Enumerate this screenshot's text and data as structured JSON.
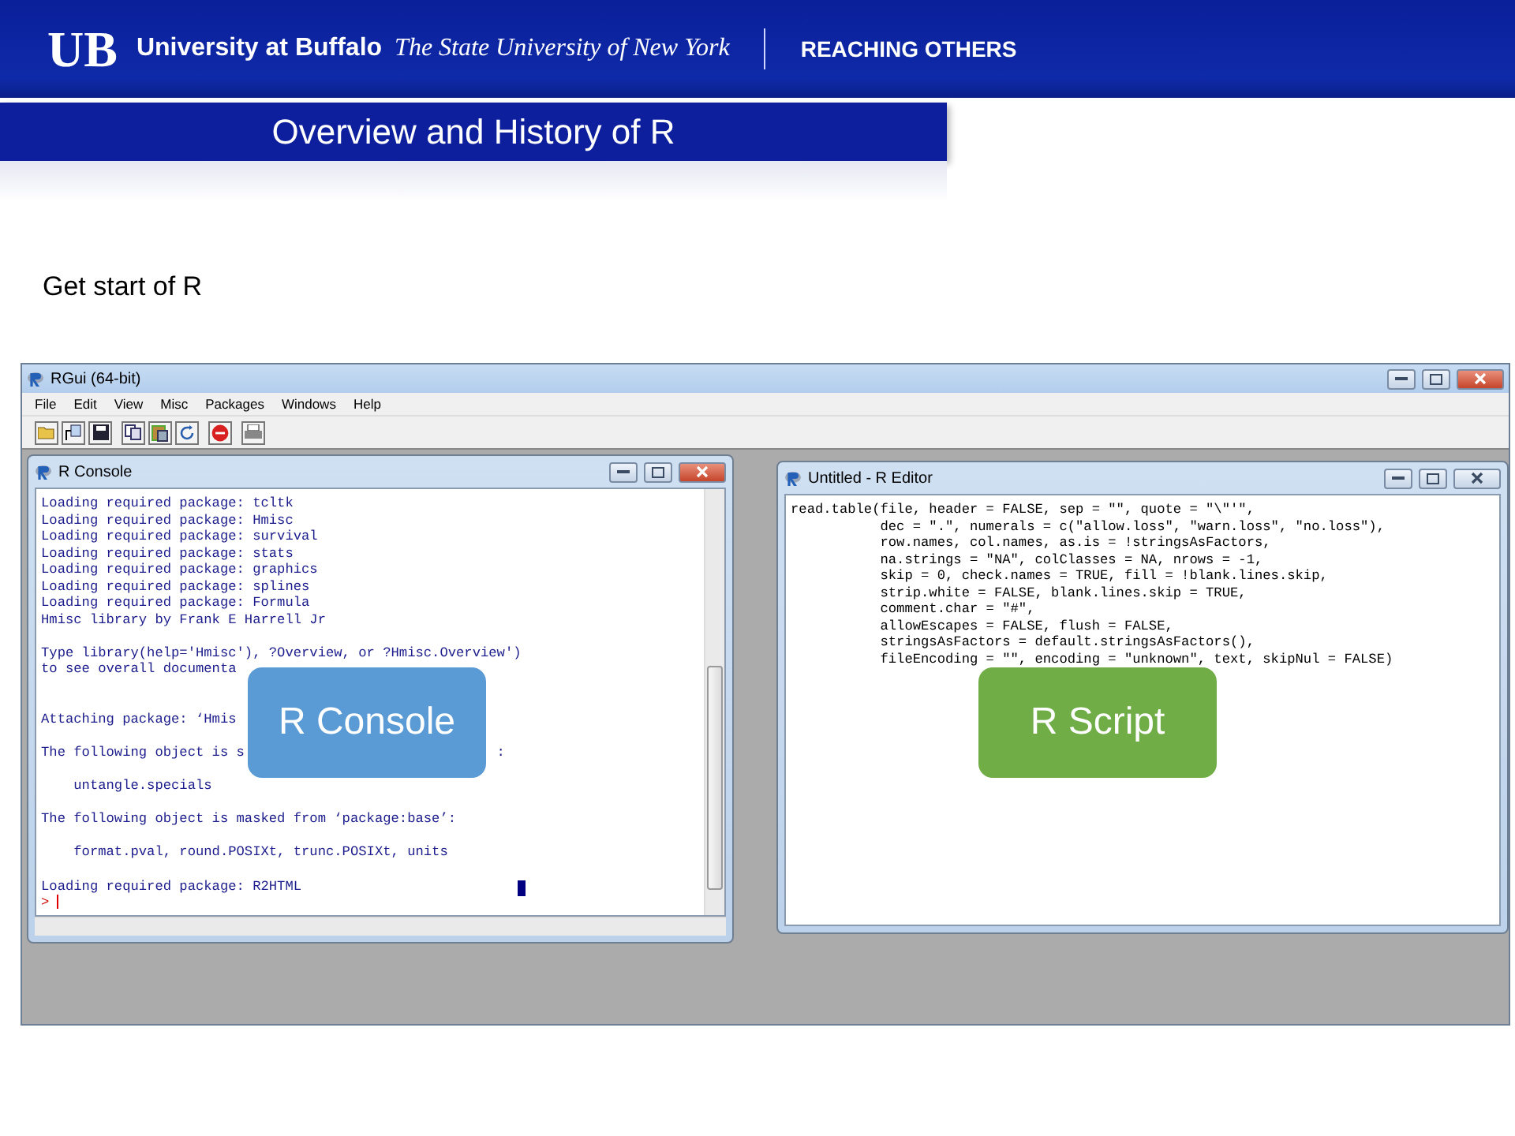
{
  "header": {
    "logo": "UB",
    "university": "University at Buffalo",
    "system": "The State University of New York",
    "tagline": "REACHING OTHERS"
  },
  "slide_title": "Overview and History of R",
  "subtitle": "Get start of R",
  "rgui": {
    "title": "RGui (64-bit)",
    "menu": [
      "File",
      "Edit",
      "View",
      "Misc",
      "Packages",
      "Windows",
      "Help"
    ],
    "toolbar": [
      {
        "kind": "open"
      },
      {
        "kind": "load"
      },
      {
        "kind": "save"
      },
      {
        "kind": "copy"
      },
      {
        "kind": "paste"
      },
      {
        "kind": "copy-paste"
      },
      {
        "kind": "stop"
      },
      {
        "kind": "print"
      }
    ],
    "console": {
      "title": "R Console",
      "active": true,
      "lines": [
        {
          "kind": "text",
          "text": "Loading required package: tcltk"
        },
        {
          "kind": "text",
          "text": "Loading required package: Hmisc"
        },
        {
          "kind": "text",
          "text": "Loading required package: survival"
        },
        {
          "kind": "text",
          "text": "Loading required package: stats"
        },
        {
          "kind": "text",
          "text": "Loading required package: graphics"
        },
        {
          "kind": "text",
          "text": "Loading required package: splines"
        },
        {
          "kind": "text",
          "text": "Loading required package: Formula"
        },
        {
          "kind": "text",
          "text": "Hmisc library by Frank E Harrell Jr"
        },
        {
          "kind": "blank"
        },
        {
          "kind": "text",
          "text": "Type library(help='Hmisc'), ?Overview, or ?Hmisc.Overview')"
        },
        {
          "kind": "text",
          "text": "to see overall documenta"
        },
        {
          "kind": "blank"
        },
        {
          "kind": "blank"
        },
        {
          "kind": "text",
          "text": "Attaching package: ‘Hmis"
        },
        {
          "kind": "blank"
        },
        {
          "kind": "text",
          "text": "The following object is s",
          "tail": ":"
        },
        {
          "kind": "blank"
        },
        {
          "kind": "text",
          "text": "    untangle.specials"
        },
        {
          "kind": "blank"
        },
        {
          "kind": "text",
          "text": "The following object is masked from ‘package:base’:"
        },
        {
          "kind": "blank"
        },
        {
          "kind": "text",
          "text": "    format.pval, round.POSIXt, trunc.POSIXt, units"
        },
        {
          "kind": "blank"
        },
        {
          "kind": "text",
          "text": "Loading required package: R2HTML"
        }
      ],
      "prompt": ">"
    },
    "editor": {
      "title": "Untitled - R Editor",
      "active": false,
      "lines": [
        "read.table(file, header = FALSE, sep = \"\", quote = \"\\\"'\",",
        "           dec = \".\", numerals = c(\"allow.loss\", \"warn.loss\", \"no.loss\"),",
        "           row.names, col.names, as.is = !stringsAsFactors,",
        "           na.strings = \"NA\", colClasses = NA, nrows = -1,",
        "           skip = 0, check.names = TRUE, fill = !blank.lines.skip,",
        "           strip.white = FALSE, blank.lines.skip = TRUE,",
        "           comment.char = \"#\",",
        "           allowEscapes = FALSE, flush = FALSE,",
        "           stringsAsFactors = default.stringsAsFactors(),",
        "           fileEncoding = \"\", encoding = \"unknown\", text, skipNul = FALSE)"
      ]
    }
  },
  "callouts": [
    {
      "label": "R Console",
      "color": "#5b9bd5"
    },
    {
      "label": "R Script",
      "color": "#70ad47"
    }
  ]
}
